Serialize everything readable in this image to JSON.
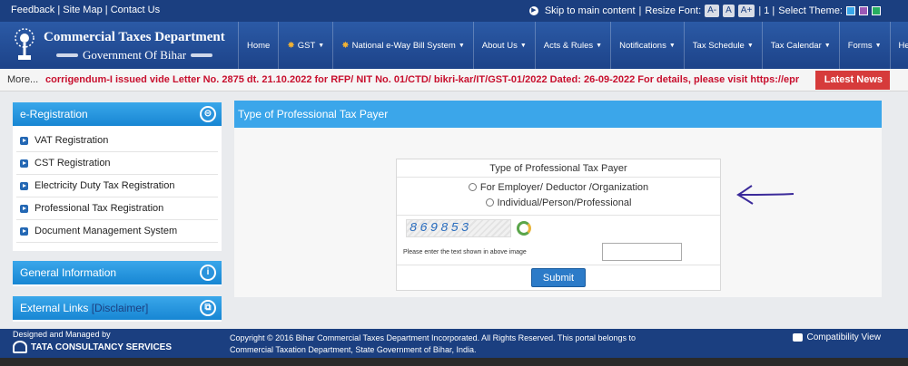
{
  "topbar": {
    "links": [
      "Feedback",
      "Site Map",
      "Contact Us"
    ],
    "skip": "Skip to main content",
    "resize_label": "Resize Font:",
    "font_buttons": [
      "A-",
      "A",
      "A+"
    ],
    "font_sep": "| 1 |",
    "theme_label": "Select Theme:",
    "theme_colors": [
      "#3aa7ea",
      "#9b59b6",
      "#27ae60"
    ]
  },
  "header": {
    "brand_title": "Commercial Taxes Department",
    "brand_subtitle": "Government Of Bihar",
    "nav": [
      {
        "label": "Home",
        "caret": false,
        "star": false
      },
      {
        "label": "GST",
        "caret": true,
        "star": true
      },
      {
        "label": "National e-Way Bill System",
        "caret": true,
        "star": true
      },
      {
        "label": "About Us",
        "caret": true,
        "star": false
      },
      {
        "label": "Acts & Rules",
        "caret": true,
        "star": false
      },
      {
        "label": "Notifications",
        "caret": true,
        "star": false
      },
      {
        "label": "Tax Schedule",
        "caret": true,
        "star": false
      },
      {
        "label": "Tax Calendar",
        "caret": true,
        "star": false
      },
      {
        "label": "Forms",
        "caret": true,
        "star": false
      },
      {
        "label": "Help",
        "caret": true,
        "star": false
      }
    ]
  },
  "ticker": {
    "more": "More...",
    "message": "corrigendum-I issued vide Letter No. 2875 dt. 21.10.2022 for RFP/ NIT No. 01/CTD/ bikri-kar/IT/GST-01/2022 Dated: 26-09-2022 For details, please visit https://epr",
    "latest_news": "Latest News"
  },
  "sidebar": {
    "registration_title": "e-Registration",
    "registration_items": [
      "VAT Registration",
      "CST Registration",
      "Electricity Duty Tax Registration",
      "Professional Tax Registration",
      "Document Management System"
    ],
    "general_info": "General Information",
    "external_links": "External Links",
    "disclaimer": "[Disclaimer]"
  },
  "main": {
    "title": "Type of Professional Tax Payer",
    "form_title": "Type of Professional Tax Payer",
    "options": [
      "For Employer/ Deductor /Organization",
      "Individual/Person/Professional"
    ],
    "captcha_text": "869853",
    "captcha_label": "Please enter the text shown in above image",
    "captcha_value": "",
    "submit": "Submit"
  },
  "footer": {
    "designed_by": "Designed and Managed by",
    "tcs": "TATA CONSULTANCY SERVICES",
    "copyright": "Copyright © 2016 Bihar Commercial Taxes Department Incorporated. All Rights Reserved. This portal belongs to Commercial Taxation Department, State Government of Bihar, India.",
    "compat": "Compatibility View"
  }
}
